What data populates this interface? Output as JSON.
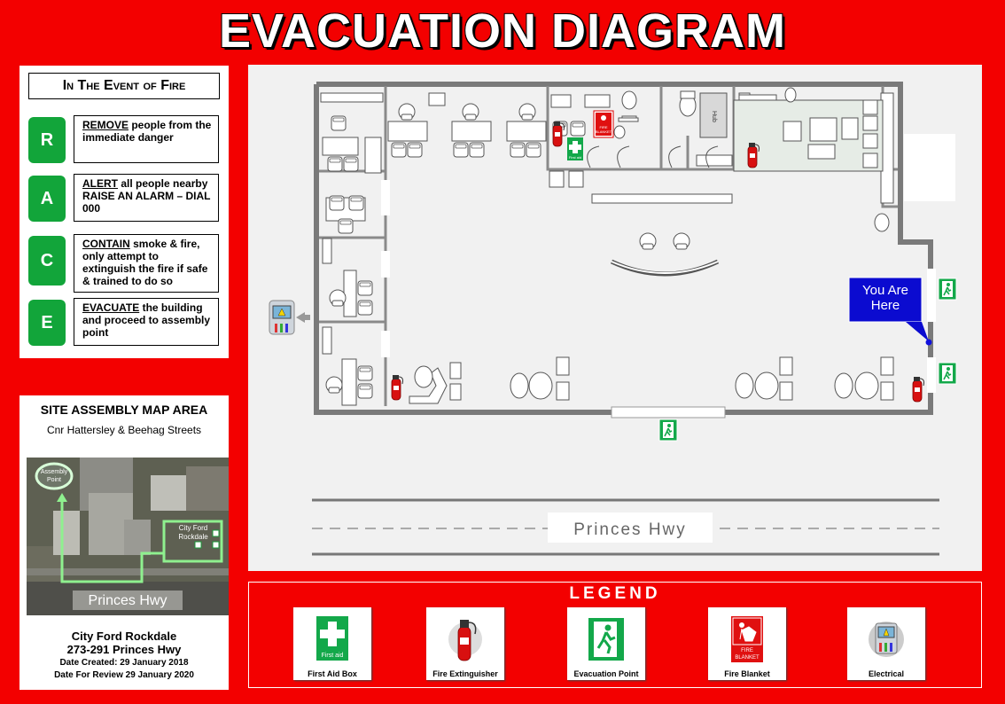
{
  "title": "EVACUATION DIAGRAM",
  "race": {
    "heading": "In The Event of Fire",
    "steps": [
      {
        "letter": "R",
        "keyword": "REMOVE",
        "text": " people from the immediate danger"
      },
      {
        "letter": "A",
        "keyword": "ALERT",
        "text": " all people nearby RAISE AN ALARM – DIAL 000"
      },
      {
        "letter": "C",
        "keyword": "CONTAIN",
        "text": " smoke & fire, only  attempt to extinguish the fire if safe & trained to do so"
      },
      {
        "letter": "E",
        "keyword": "EVACUATE",
        "text": " the building and proceed to assembly point"
      }
    ]
  },
  "assembly": {
    "title": "SITE ASSEMBLY MAP AREA",
    "subtitle": "Cnr Hattersley & Beehag Streets",
    "map_assembly_label_1": "Assembly",
    "map_assembly_label_2": "Point",
    "map_site_label_1": "City Ford",
    "map_site_label_2": "Rockdale",
    "map_road_label": "Princes Hwy"
  },
  "site": {
    "name": "City Ford Rockdale",
    "address": "273-291 Princes Hwy",
    "date_created": "Date Created: 29 January 2018",
    "date_review": "Date For Review 29 January 2020"
  },
  "plan": {
    "you_are_here_1": "You Are",
    "you_are_here_2": "Here",
    "hub_label": "Hub",
    "fire_blanket_1": "FIRE",
    "fire_blanket_2": "BLANKET",
    "first_aid_small": "First aid",
    "road_label": "Princes Hwy"
  },
  "legend": {
    "title": "LEGEND",
    "items": [
      {
        "label": "First Aid Box",
        "icon": "first-aid-box-icon"
      },
      {
        "label": "Fire Extinguisher",
        "icon": "fire-extinguisher-icon"
      },
      {
        "label": "Evacuation Point",
        "icon": "evacuation-point-icon"
      },
      {
        "label": "Fire Blanket",
        "icon": "fire-blanket-icon"
      },
      {
        "label": "Electrical",
        "icon": "electrical-icon"
      }
    ],
    "first_aid_text": "First aid",
    "blanket_text_1": "FIRE",
    "blanket_text_2": "BLANKET"
  },
  "colors": {
    "background_red": "#f30000",
    "race_green": "#12a53a",
    "you_are_here_blue": "#0b0bd0",
    "wall_gray": "#7a7a7a"
  }
}
